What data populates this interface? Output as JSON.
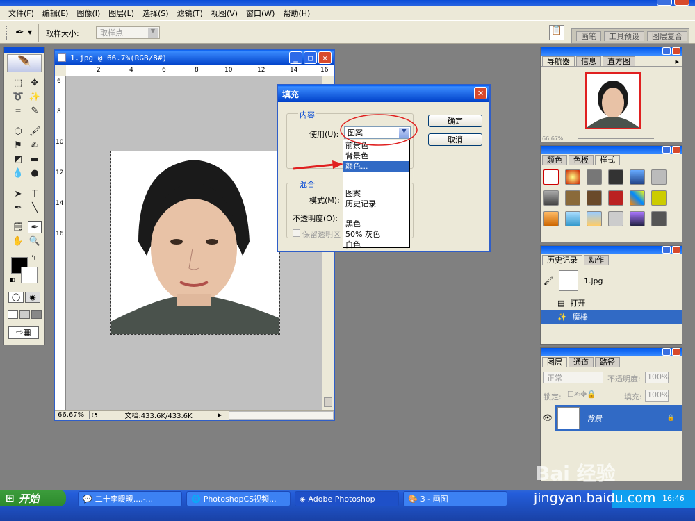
{
  "menubar": {
    "items": [
      "文件(F)",
      "编辑(E)",
      "图像(I)",
      "图层(L)",
      "选择(S)",
      "滤镜(T)",
      "视图(V)",
      "窗口(W)",
      "帮助(H)"
    ]
  },
  "options": {
    "sample_size_label": "取样大小:",
    "sample_size_value": "取样点",
    "palette_tabs": [
      "画笔",
      "工具预设",
      "图层复合"
    ]
  },
  "document": {
    "title": "1.jpg @ 66.7%(RGB/8#)",
    "zoom": "66.67%",
    "doc_info": "文档:433.6K/433.6K",
    "ruler_h": [
      "2",
      "4",
      "6",
      "8",
      "10",
      "12",
      "14",
      "16"
    ],
    "ruler_v": [
      "6",
      "8",
      "10",
      "12",
      "14",
      "16"
    ]
  },
  "dialog": {
    "title": "填充",
    "content_group": "内容",
    "use_label": "使用(U):",
    "use_value": "图案",
    "blend_group": "混合",
    "mode_label": "模式(M):",
    "opacity_label": "不透明度(O):",
    "preserve_label": "保留透明区",
    "ok": "确定",
    "cancel": "取消",
    "options": [
      "前景色",
      "背景色",
      "颜色...",
      "图案",
      "历史记录",
      "黑色",
      "50% 灰色",
      "白色"
    ],
    "selected_option": "颜色..."
  },
  "navigator": {
    "tabs": [
      "导航器",
      "信息",
      "直方图"
    ],
    "zoom": "66.67%"
  },
  "styles": {
    "tabs": [
      "颜色",
      "色板",
      "样式"
    ]
  },
  "history": {
    "tabs": [
      "历史记录",
      "动作"
    ],
    "snapshot": "1.jpg",
    "items": [
      "打开",
      "魔棒"
    ]
  },
  "layers": {
    "tabs": [
      "图层",
      "通道",
      "路径"
    ],
    "blend_mode": "正常",
    "opacity_label": "不透明度:",
    "opacity": "100%",
    "lock_label": "锁定:",
    "fill_label": "填充:",
    "fill": "100%",
    "layer_name": "背景"
  },
  "taskbar": {
    "start": "开始",
    "tasks": [
      "二十李暖暖....-...",
      "PhotoshopCS视频...",
      "Adobe Photoshop",
      "3 - 画图"
    ],
    "clock": "16:46"
  },
  "watermark": {
    "brand": "Bai 经验",
    "url": "jingyan.baidu.com"
  },
  "colors": {
    "accent": "#0a58e0",
    "selection": "#316ac5",
    "dialog_bg": "#ece9d8",
    "workspace": "#808080",
    "annotation": "#e02020"
  }
}
